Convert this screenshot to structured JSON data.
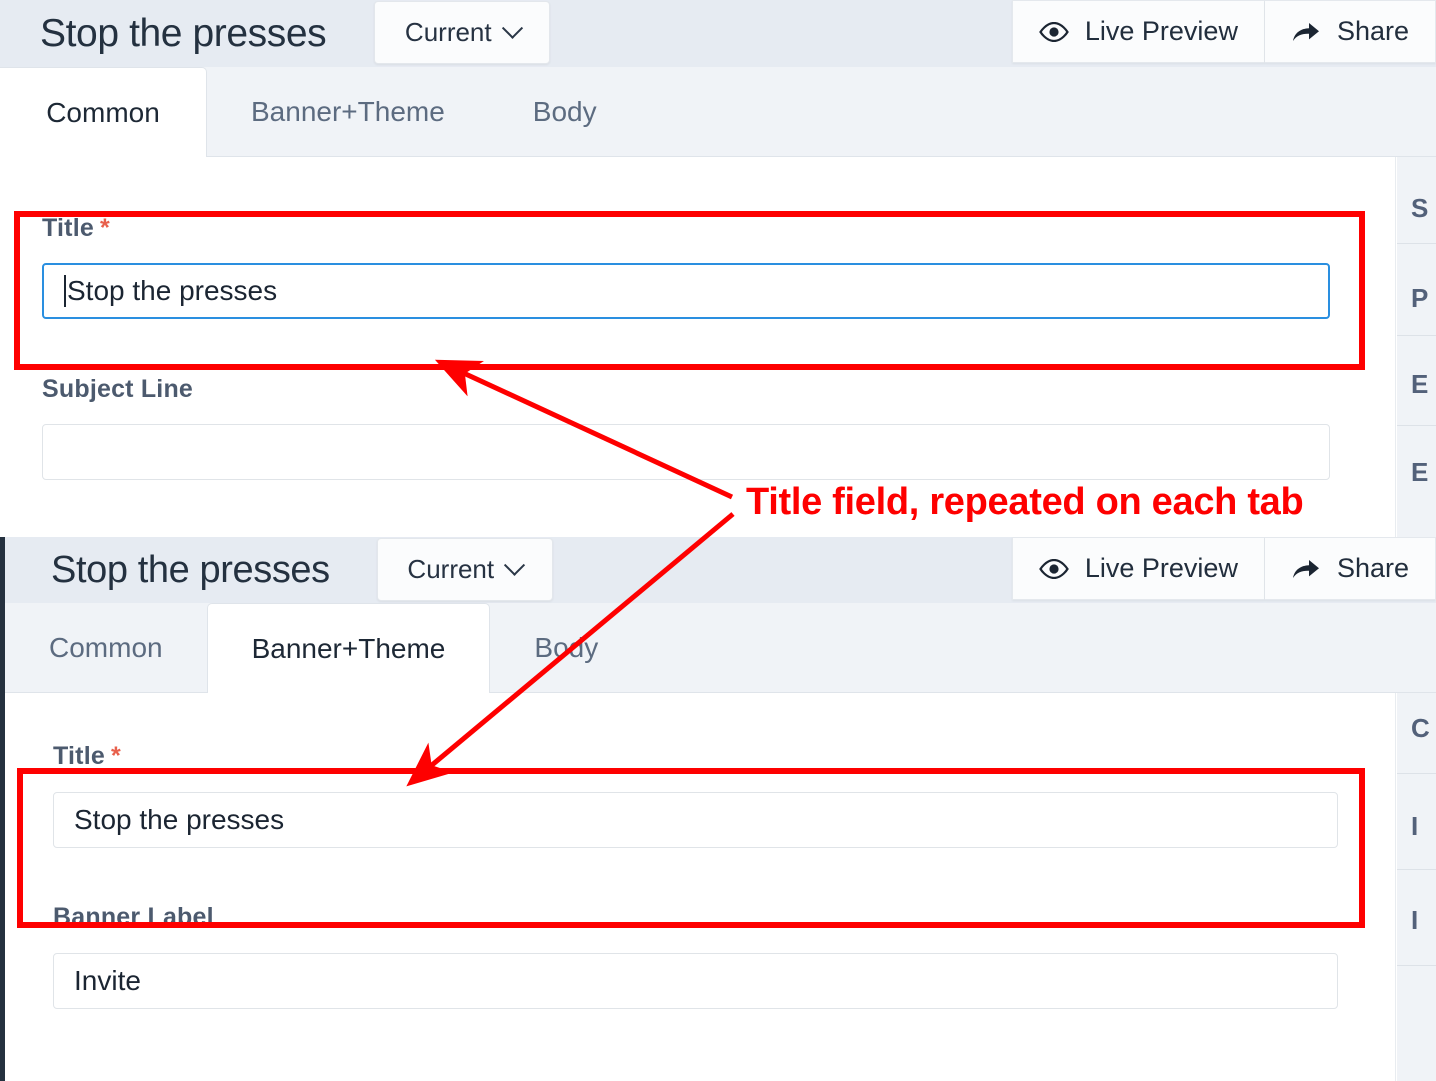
{
  "annotation": {
    "text": "Title field, repeated on each tab",
    "color": "#fe0000",
    "arrow_count": 2
  },
  "panels": [
    {
      "id": "common-tab-panel",
      "header": {
        "title": "Stop the presses",
        "version_button": {
          "label": "Current",
          "icon": "chevron-down-icon"
        },
        "actions": [
          {
            "label": "Live Preview",
            "icon": "eye-icon"
          },
          {
            "label": "Share",
            "icon": "share-arrow-icon"
          }
        ]
      },
      "tabs": [
        {
          "label": "Common",
          "active": true
        },
        {
          "label": "Banner+Theme",
          "active": false
        },
        {
          "label": "Body",
          "active": false
        }
      ],
      "fields": [
        {
          "label": "Title",
          "required": true,
          "required_marker": "*",
          "value": "Stop the presses",
          "placeholder": "",
          "focused": true,
          "highlighted": true
        },
        {
          "label": "Subject Line",
          "required": false,
          "required_marker": "",
          "value": "",
          "placeholder": "",
          "focused": false,
          "highlighted": false
        }
      ],
      "rail_items": [
        "S",
        "P",
        "E",
        "E"
      ]
    },
    {
      "id": "banner-theme-tab-panel",
      "header": {
        "title": "Stop the presses",
        "version_button": {
          "label": "Current",
          "icon": "chevron-down-icon"
        },
        "actions": [
          {
            "label": "Live Preview",
            "icon": "eye-icon"
          },
          {
            "label": "Share",
            "icon": "share-arrow-icon"
          }
        ]
      },
      "tabs": [
        {
          "label": "Common",
          "active": false
        },
        {
          "label": "Banner+Theme",
          "active": true
        },
        {
          "label": "Body",
          "active": false
        }
      ],
      "fields": [
        {
          "label": "Title",
          "required": true,
          "required_marker": "*",
          "value": "Stop the presses",
          "placeholder": "",
          "focused": false,
          "highlighted": true
        },
        {
          "label": "Banner Label",
          "required": false,
          "required_marker": "",
          "value": "Invite",
          "placeholder": "",
          "focused": false,
          "highlighted": false
        }
      ],
      "rail_items": [
        "C",
        "I",
        "I",
        ""
      ]
    }
  ],
  "colors": {
    "header_bg": "#e6ebf2",
    "tabstrip_bg": "#f0f3f7",
    "accent_focus": "#2a8fe0",
    "required_star": "#e8604c",
    "annotation_red": "#fe0000",
    "label_text": "#4c5a6e",
    "panel_divider": "#25313f"
  }
}
